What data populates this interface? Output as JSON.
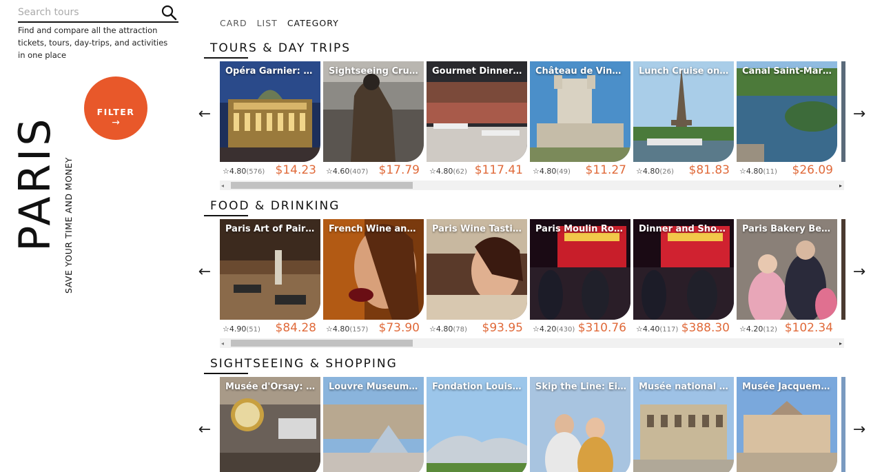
{
  "search": {
    "placeholder": "Search tours"
  },
  "tagline": "Find and compare all the attraction tickets, tours, day-trips, and activities in one place",
  "filter": {
    "label": "FILTER",
    "arrow": "→"
  },
  "brand": {
    "title": "PARIS",
    "subtitle": "SAVE YOUR TIME AND MONEY"
  },
  "view_tabs": [
    "CARD",
    "LIST",
    "CATEGORY"
  ],
  "colors": {
    "accent": "#e8582a",
    "price": "#e06a3a"
  },
  "nav": {
    "prev": "←",
    "next": "→",
    "scroll_left": "◂",
    "scroll_right": "▸",
    "star": "☆"
  },
  "sections": [
    {
      "title": "TOURS & DAY TRIPS",
      "cards": [
        {
          "title": "Opéra Garnier: Sel...",
          "rating": "4.80",
          "reviews": "(576)",
          "price": "$14.23"
        },
        {
          "title": "Sightseeing Cruis...",
          "rating": "4.60",
          "reviews": "(407)",
          "price": "$17.79"
        },
        {
          "title": "Gourmet Dinner C...",
          "rating": "4.80",
          "reviews": "(62)",
          "price": "$117.41"
        },
        {
          "title": "Château de Vince...",
          "rating": "4.80",
          "reviews": "(49)",
          "price": "$11.27"
        },
        {
          "title": "Lunch Cruise on t...",
          "rating": "4.80",
          "reviews": "(26)",
          "price": "$81.83"
        },
        {
          "title": "Canal Saint-Marti...",
          "rating": "4.80",
          "reviews": "(11)",
          "price": "$26.09"
        }
      ]
    },
    {
      "title": "FOOD & DRINKING",
      "cards": [
        {
          "title": "Paris Art of Pairin...",
          "rating": "4.90",
          "reviews": "(51)",
          "price": "$84.28"
        },
        {
          "title": "French Wine and ...",
          "rating": "4.80",
          "reviews": "(157)",
          "price": "$73.90"
        },
        {
          "title": "Paris Wine Tasting...",
          "rating": "4.80",
          "reviews": "(78)",
          "price": "$93.95"
        },
        {
          "title": "Paris Moulin Roug...",
          "rating": "4.20",
          "reviews": "(430)",
          "price": "$310.76"
        },
        {
          "title": "Dinner and Show ...",
          "rating": "4.40",
          "reviews": "(117)",
          "price": "$388.30"
        },
        {
          "title": "Paris Bakery Behin...",
          "rating": "4.20",
          "reviews": "(12)",
          "price": "$102.34"
        }
      ]
    },
    {
      "title": "SIGHTSEEING & SHOPPING",
      "cards": [
        {
          "title": "Musée d'Orsay: D...",
          "rating": "",
          "reviews": "",
          "price": ""
        },
        {
          "title": "Louvre Museum: E...",
          "rating": "",
          "reviews": "",
          "price": ""
        },
        {
          "title": "Fondation Louis V...",
          "rating": "",
          "reviews": "",
          "price": ""
        },
        {
          "title": "Skip the Line: Eiff...",
          "rating": "",
          "reviews": "",
          "price": ""
        },
        {
          "title": "Musée national Pi...",
          "rating": "",
          "reviews": "",
          "price": ""
        },
        {
          "title": "Musée Jacquemar...",
          "rating": "",
          "reviews": "",
          "price": ""
        }
      ]
    }
  ]
}
